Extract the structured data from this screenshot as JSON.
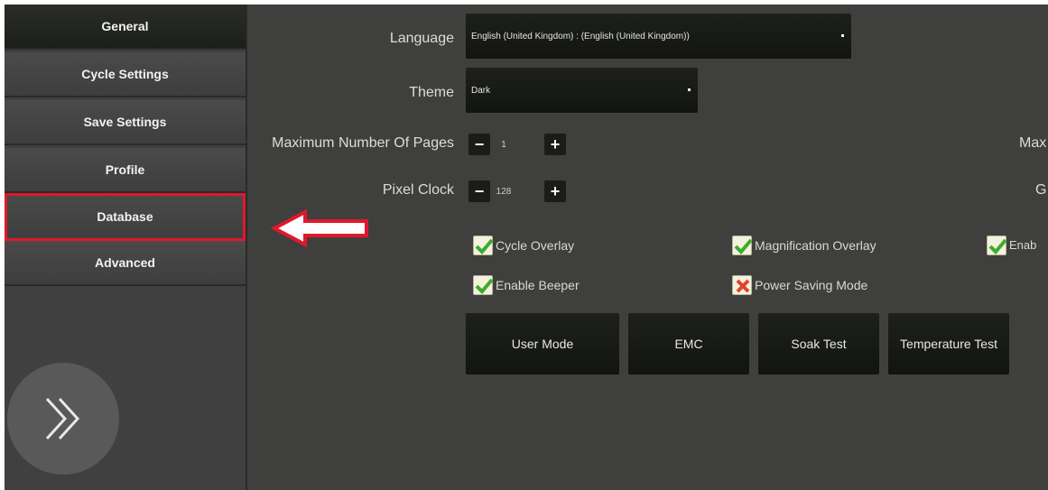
{
  "sidebar": {
    "items": [
      {
        "label": "General"
      },
      {
        "label": "Cycle Settings"
      },
      {
        "label": "Save Settings"
      },
      {
        "label": "Profile"
      },
      {
        "label": "Database"
      },
      {
        "label": "Advanced"
      }
    ],
    "active_index": 0,
    "highlighted_index": 4,
    "expand_icon": "double-chevron-right-icon"
  },
  "annotation": {
    "arrow_icon": "red-arrow-left-icon",
    "arrow_color": "#e0182b"
  },
  "settings": {
    "language": {
      "label": "Language",
      "value": "English (United Kingdom) :  (English (United Kingdom))"
    },
    "theme": {
      "label": "Theme",
      "value": "Dark"
    },
    "max_pages": {
      "label": "Maximum Number Of Pages",
      "value": "1"
    },
    "pixel_clock": {
      "label": "Pixel Clock",
      "value": "128"
    },
    "cut_off_right_1": "Max",
    "cut_off_right_2": "G"
  },
  "checkboxes": [
    {
      "label": "Cycle Overlay",
      "checked": true
    },
    {
      "label": "Magnification Overlay",
      "checked": true
    },
    {
      "label": "Enab",
      "checked": true
    },
    {
      "label": "Enable Beeper",
      "checked": true
    },
    {
      "label": "Power Saving Mode",
      "checked": false
    }
  ],
  "buttons": {
    "user_mode": "User Mode",
    "emc": "EMC",
    "soak_test": "Soak Test",
    "temperature_test": "Temperature Test"
  },
  "stepper": {
    "minus": "−",
    "plus": "+"
  },
  "colors": {
    "background": "#3f3f3d",
    "check_green": "#3dab2c",
    "cross_red": "#e0442a",
    "highlight_red": "#e0182b"
  }
}
